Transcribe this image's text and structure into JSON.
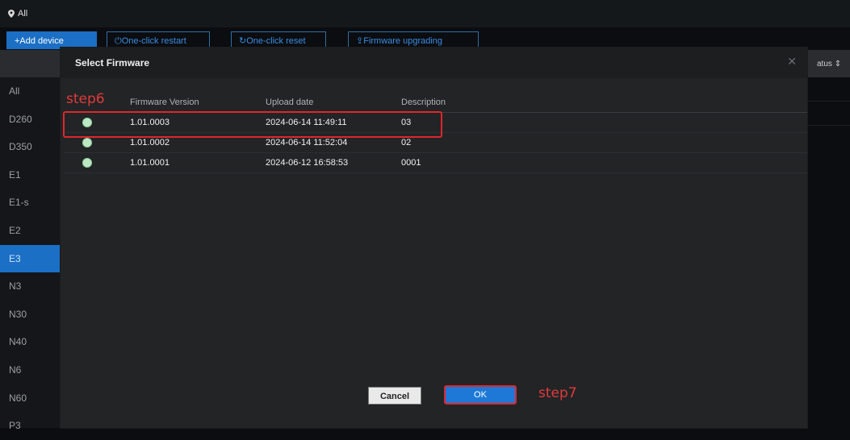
{
  "location": {
    "label": "All"
  },
  "toolbar": {
    "add_device": "+Add device",
    "restart": "One-click restart",
    "reset": "One-click reset",
    "upgrade": "Firmware upgrading"
  },
  "table_header": {
    "status": "atus"
  },
  "sidebar": {
    "items": [
      {
        "label": "All"
      },
      {
        "label": "D260"
      },
      {
        "label": "D350"
      },
      {
        "label": "E1"
      },
      {
        "label": "E1-s"
      },
      {
        "label": "E2"
      },
      {
        "label": "E3"
      },
      {
        "label": "N3"
      },
      {
        "label": "N30"
      },
      {
        "label": "N40"
      },
      {
        "label": "N6"
      },
      {
        "label": "N60"
      },
      {
        "label": "P3"
      }
    ],
    "active": "E3"
  },
  "modal": {
    "title": "Select Firmware",
    "columns": {
      "version": "Firmware Version",
      "date": "Upload date",
      "description": "Description"
    },
    "rows": [
      {
        "version": "1.01.0003",
        "date": "2024-06-14 11:49:11",
        "description": "03"
      },
      {
        "version": "1.01.0002",
        "date": "2024-06-14 11:52:04",
        "description": "02"
      },
      {
        "version": "1.01.0001",
        "date": "2024-06-12 16:58:53",
        "description": "0001"
      }
    ],
    "cancel": "Cancel",
    "ok": "OK"
  },
  "annotations": {
    "step6": "step6",
    "step7": "step7"
  },
  "colors": {
    "accent": "#1b6fc5",
    "highlight": "#e0262b",
    "radio": "#bde8c4"
  }
}
